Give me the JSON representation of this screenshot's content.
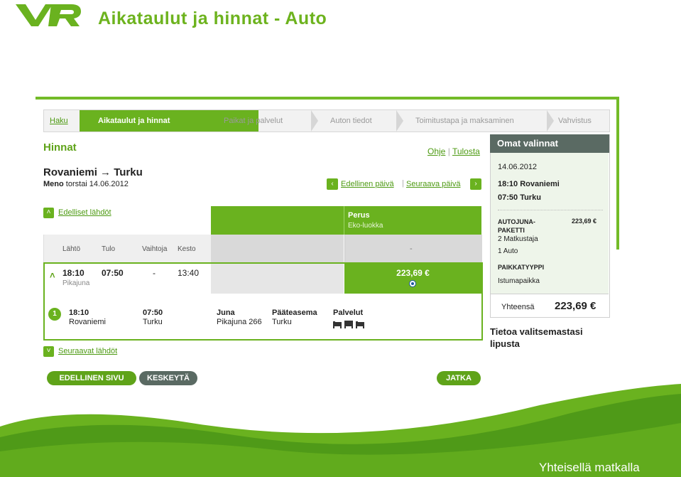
{
  "slide": {
    "title": "Aikataulut ja hinnat - Auto",
    "logo": "VR",
    "footer_slogan": "Yhteisellä matkalla"
  },
  "steps": [
    "Haku",
    "Aikataulut ja hinnat",
    "Paikat ja palvelut",
    "Auton tiedot",
    "Toimitustapa ja maksaminen",
    "Vahvistus"
  ],
  "prices": {
    "heading": "Hinnat",
    "help_link": "Ohje",
    "print_link": "Tulosta",
    "route": "Rovaniemi → Turku",
    "direction_label": "Meno",
    "date_text": "torstai 14.06.2012",
    "prev_day": "Edellinen päivä",
    "next_day": "Seuraava päivä",
    "prev_departures": "Edelliset lähdöt",
    "next_departures": "Seuraavat lähdöt"
  },
  "table": {
    "columns": [
      "Lähtö",
      "Tulo",
      "Vaihtoja",
      "Kesto"
    ],
    "fare_class": "Perus",
    "fare_subclass": "Eko-luokka",
    "fare_dash": "-",
    "row": {
      "depart": "18:10",
      "arrive": "07:50",
      "changes": "-",
      "duration": "13:40",
      "train_type": "Pikajuna",
      "price": "223,69 €"
    },
    "detail": {
      "leg_no": "1",
      "depart_time": "18:10",
      "depart_station": "Rovaniemi",
      "arrive_time": "07:50",
      "arrive_station": "Turku",
      "train_label": "Juna",
      "train_value": "Pikajuna 266",
      "terminus_label": "Pääteasema",
      "terminus_value": "Turku",
      "services_label": "Palvelut",
      "service_icons": [
        "bed-icon",
        "seat-icon",
        "bed-icon"
      ]
    }
  },
  "buttons": {
    "previous_page": "EDELLINEN SIVU",
    "cancel": "KESKEYTÄ",
    "continue": "JATKA"
  },
  "summary": {
    "title": "Omat valinnat",
    "date": "14.06.2012",
    "depart": "18:10 Rovaniemi",
    "arrive": "07:50 Turku",
    "package_label": "AUTOJUNA-\nPAKETTI",
    "package_price": "223,69 €",
    "travellers": "2 Matkustaja",
    "cars": "1 Auto",
    "seat_type_label": "PAIKKATYYPPI",
    "seat_type_value": "Istumapaikka",
    "total_label": "Yhteensä",
    "total_value": "223,69 €",
    "ticket_info": "Tietoa valitsemastasi lipusta"
  },
  "colors": {
    "brand_green": "#6ab21f",
    "dark_header": "#5a6a63",
    "light_panel": "#eef5ea"
  }
}
